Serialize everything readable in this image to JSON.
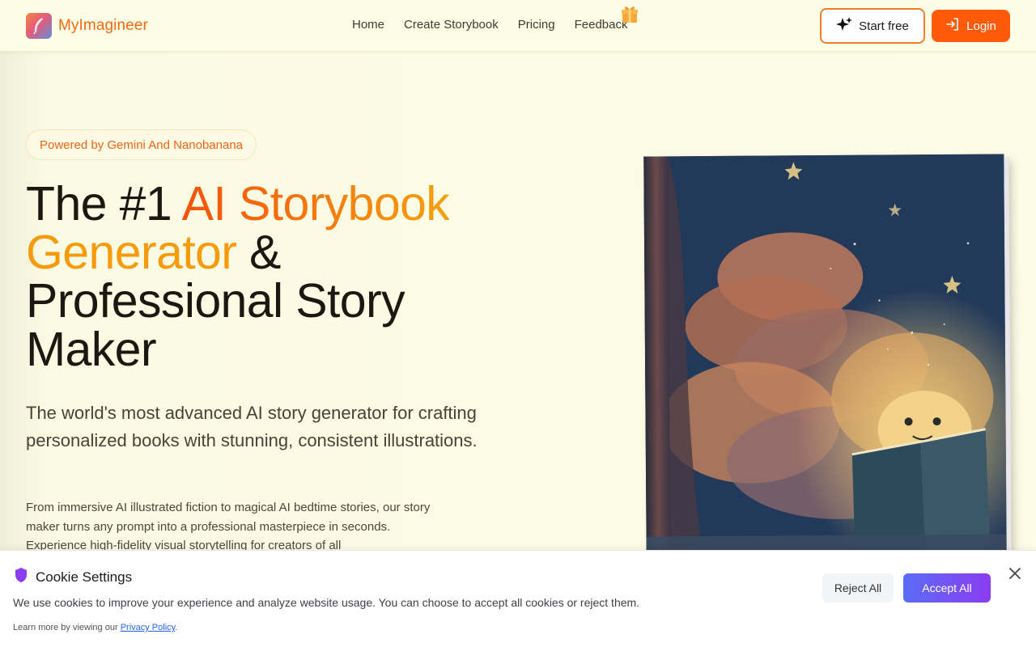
{
  "header": {
    "brand": "MyImagineer",
    "nav": [
      "Home",
      "Create Storybook",
      "Pricing",
      "Feedback"
    ],
    "start_label": "Start free",
    "login_label": "Login"
  },
  "hero": {
    "badge": "Powered by Gemini And Nanobanana",
    "title_part1": "The #1 ",
    "title_highlight1": "AI Storybook",
    "title_highlight2": "Generator",
    "title_part2": " &",
    "title_part3": "Professional Story",
    "title_part4": "Maker",
    "subtitle": "The world's most advanced AI story generator for crafting personalized books with stunning, consistent illustrations.",
    "body": "From immersive AI illustrated fiction to magical AI bedtime stories, our story maker turns any prompt into a professional masterpiece in seconds. Experience high-fidelity visual storytelling for creators of all"
  },
  "cookie": {
    "title": "Cookie Settings",
    "description": "We use cookies to improve your experience and analyze website usage. You can choose to accept all cookies or reject them.",
    "learn_prefix": "Learn more by viewing our ",
    "policy_link": "Privacy Policy",
    "learn_suffix": ".",
    "reject_label": "Reject All",
    "accept_label": "Accept All"
  },
  "colors": {
    "brand_orange": "#ff5a0a",
    "accent_gold": "#f59a0c",
    "accept_start": "#5b6cf6",
    "accept_end": "#8b3cf0"
  },
  "icons": {
    "logo": "feather-quill-icon",
    "gift": "gift-icon",
    "start": "sparkle-icon",
    "login": "login-arrow-icon",
    "cookie": "shield-icon",
    "close": "close-icon"
  }
}
